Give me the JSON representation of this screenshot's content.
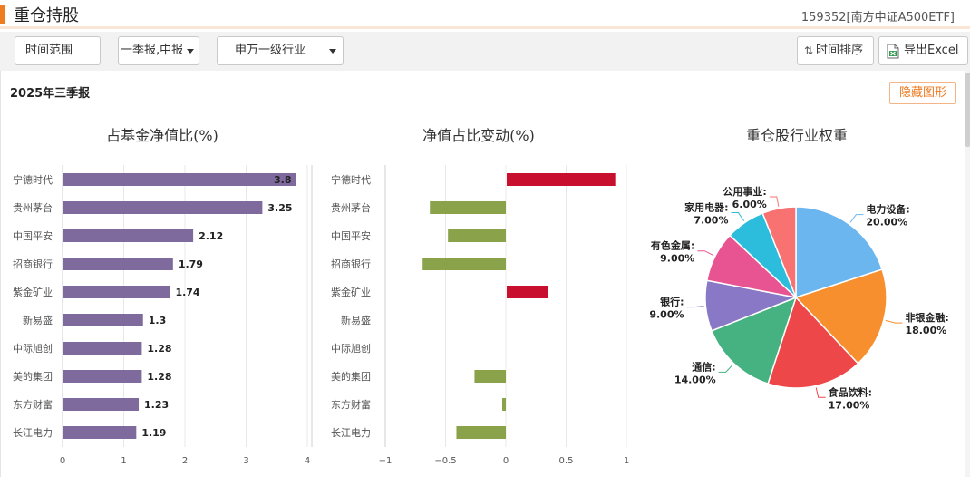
{
  "header": {
    "title": "重仓持股",
    "fund_name": "159352[南方中证A500ETF]"
  },
  "toolbar": {
    "time_range_label": "时间范围",
    "period_select_value": "一季报,中报",
    "industry_select_value": "申万一级行业",
    "time_sort_label": "时间排序",
    "export_label": "导出Excel"
  },
  "content": {
    "period_label": "2025年三季报",
    "hide_chart_label": "隐藏图形"
  },
  "colors": {
    "accent": "#f07c22",
    "bar": "#7e6a9c",
    "positive": "#c8102e",
    "negative": "#8aa34a"
  },
  "chart_data": [
    {
      "type": "bar",
      "orientation": "horizontal",
      "title": "占基金净值比(%)",
      "categories": [
        "宁德时代",
        "贵州茅台",
        "中国平安",
        "招商银行",
        "紫金矿业",
        "新易盛",
        "中际旭创",
        "美的集团",
        "东方财富",
        "长江电力"
      ],
      "values": [
        3.8,
        3.25,
        2.12,
        1.79,
        1.74,
        1.3,
        1.28,
        1.28,
        1.23,
        1.19
      ],
      "xlim": [
        0,
        4
      ],
      "xticks": [
        0,
        1,
        2,
        3,
        4
      ],
      "grid": true
    },
    {
      "type": "bar",
      "orientation": "horizontal",
      "title": "净值占比变动(%)",
      "categories": [
        "宁德时代",
        "贵州茅台",
        "中国平安",
        "招商银行",
        "紫金矿业",
        "新易盛",
        "中际旭创",
        "美的集团",
        "东方财富",
        "长江电力"
      ],
      "values": [
        0.9,
        -0.63,
        -0.48,
        -0.69,
        0.34,
        0,
        0,
        -0.26,
        -0.03,
        -0.41
      ],
      "xlim": [
        -1,
        1
      ],
      "xticks": [
        "−1",
        "−0.5",
        "0",
        "0.5",
        "1"
      ],
      "grid": true
    },
    {
      "type": "pie",
      "title": "重仓股行业权重",
      "slices": [
        {
          "name": "电力设备",
          "label": "20.00%",
          "value": 20,
          "color": "#6cb6ef"
        },
        {
          "name": "非银金融",
          "label": "18.00%",
          "value": 18,
          "color": "#f78f2e"
        },
        {
          "name": "食品饮料",
          "label": "17.00%",
          "value": 17,
          "color": "#ed4749"
        },
        {
          "name": "通信",
          "label": "14.00%",
          "value": 14,
          "color": "#47b281"
        },
        {
          "name": "银行",
          "label": "9.00%",
          "value": 9,
          "color": "#8878c5"
        },
        {
          "name": "有色金属",
          "label": "9.00%",
          "value": 9,
          "color": "#e85492"
        },
        {
          "name": "家用电器",
          "label": "7.00%",
          "value": 7,
          "color": "#2cbcdc"
        },
        {
          "name": "公用事业",
          "label": "6.00%",
          "value": 6,
          "color": "#f87272"
        }
      ]
    }
  ]
}
